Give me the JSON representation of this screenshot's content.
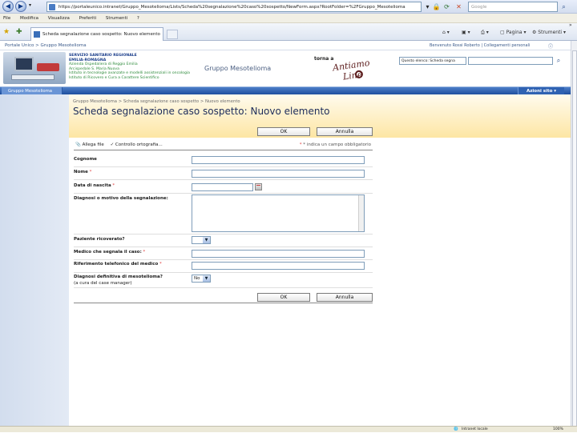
{
  "browser": {
    "url": "https://portaleunico.intranet/Gruppo_Mesotelioma/Lists/Scheda%20segnalazione%20caso%20sospetto/NewForm.aspx?RootFolder=%2FGruppo_Mesotelioma",
    "search_placeholder": "Google",
    "menu": [
      "File",
      "Modifica",
      "Visualizza",
      "Preferiti",
      "Strumenti",
      "?"
    ],
    "tab_title": "Scheda segnalazione caso sospetto: Nuovo elemento",
    "tools": {
      "page_label": "Pagina",
      "tools_label": "Strumenti"
    },
    "status_right": "Intranet locale",
    "zoom": "100%"
  },
  "sharepoint": {
    "breadcrumb_top": "Portale Unico > Gruppo Mesotelioma",
    "user_links": "Benvenuto Rossi Roberto | Collegamenti personali",
    "org_lines": [
      "SERVIZIO SANITARIO REGIONALE",
      "EMILIA-ROMAGNA",
      "Azienda Ospedaliera di Reggio Emilia",
      "Arcispedale S. Maria Nuova",
      "Istituto in tecnologie avanzate e modelli assistenziali in oncologia",
      "Istituto di Ricovero e Cura a Carattere Scientifico"
    ],
    "site_title": "Gruppo Mesotelioma",
    "torna_a": "torna a",
    "logo_lines": [
      "Antiamo",
      "Line"
    ],
    "scope_select": "Questo elenco: Scheda segna",
    "nav_tab": "Gruppo Mesotelioma",
    "site_actions": "Azioni sito"
  },
  "form": {
    "breadcrumb": "Gruppo Mesotelioma > Scheda segnalazione caso sospetto > Nuovo elemento",
    "title": "Scheda segnalazione caso sospetto: Nuovo elemento",
    "ok": "OK",
    "cancel": "Annulla",
    "attach": "Allega file",
    "spelling": "Controllo ortografia...",
    "required_note": "* indica un campo obbligatorio",
    "fields": {
      "cognome": "Cognome",
      "nome": "Nome",
      "data_nascita": "Data di nascita",
      "diagnosi_motivo": "Diagnosi o motivo della segnalazione:",
      "ricoverato": "Paziente ricoverato?",
      "medico": "Medico che segnala il caso:",
      "riferimento": "Riferimento telefonico del medico",
      "diagnosi_def_1": "Diagnosi definitiva di mesotelioma?",
      "diagnosi_def_2": "(a cura del case manager)"
    },
    "req_mark": "*",
    "diagnosi_def_value": "No"
  }
}
